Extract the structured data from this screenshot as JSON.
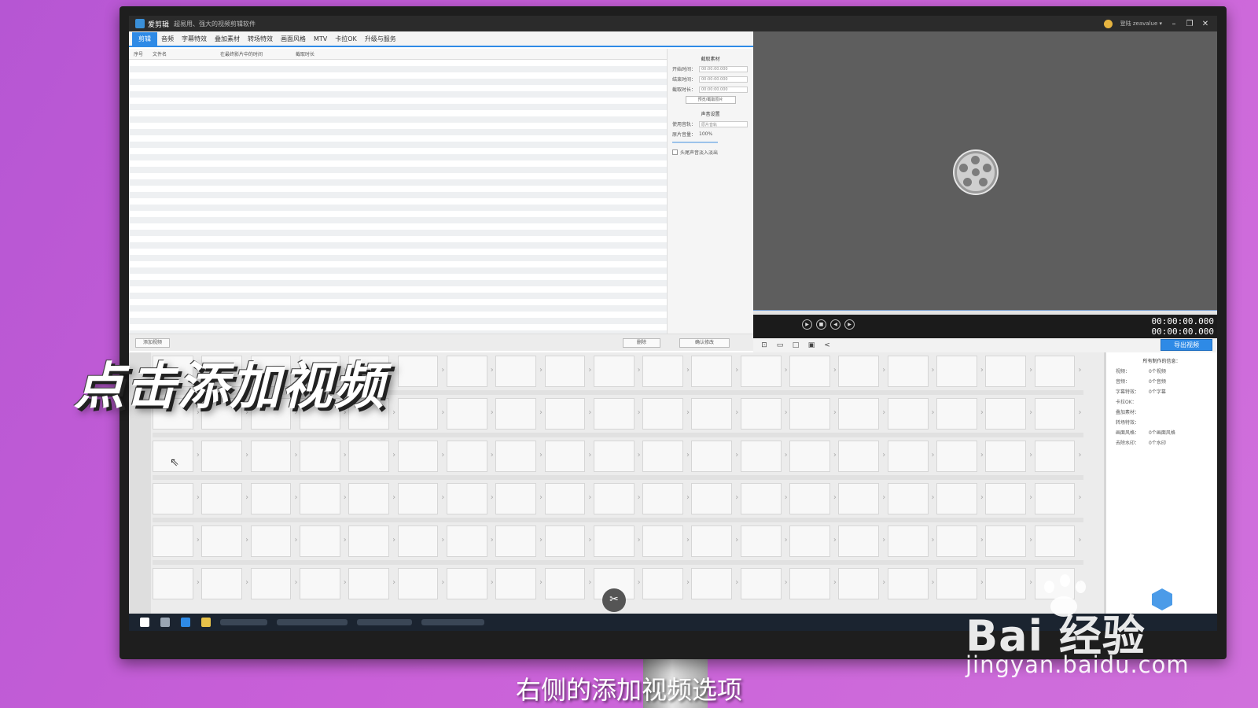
{
  "window": {
    "app_title": "爱剪辑",
    "app_subtitle": "超易用、强大的视频剪辑软件",
    "user_name": "登陆 zeavalue ▾"
  },
  "menu": {
    "items": [
      "剪辑",
      "音频",
      "字幕特效",
      "叠加素材",
      "转场特效",
      "画面风格",
      "MTV",
      "卡拉OK",
      "升级与服务"
    ]
  },
  "file_list": {
    "columns": [
      "序号",
      "文件名",
      "在最终影片中的时间",
      "截取时长"
    ]
  },
  "props": {
    "clip_header": "截取素材",
    "start_label": "开始时间：",
    "start_value": "00:00:00.000",
    "end_label": "结束时间：",
    "end_value": "00:00:00.000",
    "duration_label": "截取时长：",
    "duration_value": "00:00:00.000",
    "fetch_button": "预览/截取原片",
    "audio_header": "声音设置",
    "track_label": "使用音轨：",
    "track_value": "原片音轨",
    "volume_label": "原片音量：",
    "volume_value": "100%",
    "mute_label": "头尾声音淡入淡出",
    "confirm_button": "确认修改"
  },
  "actions": {
    "add_video": "添加视频",
    "delete": "删除"
  },
  "player": {
    "time_current": "00:00:00.000",
    "time_total": "00:00:00.000",
    "export_button": "导出视频"
  },
  "info": {
    "title": "所有制作的信息：",
    "rows": [
      {
        "k": "视频：",
        "v": "0个视频"
      },
      {
        "k": "音频：",
        "v": "0个音频"
      },
      {
        "k": "字幕特效：",
        "v": "0个字幕"
      },
      {
        "k": "卡拉OK：",
        "v": ""
      },
      {
        "k": "叠加素材：",
        "v": ""
      },
      {
        "k": "转场特效：",
        "v": ""
      },
      {
        "k": "画面风格：",
        "v": "0个画面风格"
      },
      {
        "k": "去除水印：",
        "v": "0个水印"
      }
    ]
  },
  "overlay": {
    "caption": "点击添加视频",
    "subtitle": "右侧的添加视频选项"
  },
  "watermark": {
    "brand": "Bai  经验",
    "url": "jingyan.baidu.com"
  }
}
